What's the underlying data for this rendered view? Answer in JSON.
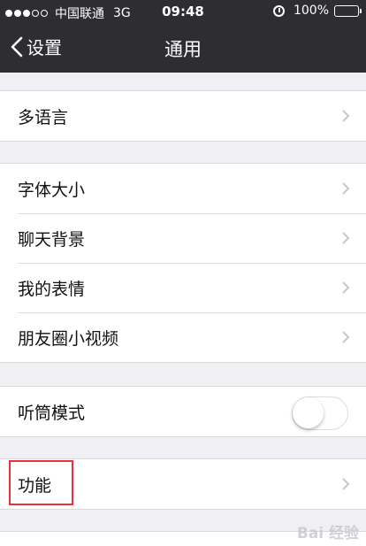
{
  "status_bar": {
    "carrier": "中国联通",
    "network": "3G",
    "time": "09:48",
    "battery": "100%",
    "battery_level": 1.0,
    "signal_bars_filled": 3,
    "signal_bars_total": 5
  },
  "nav": {
    "back_label": "设置",
    "title": "通用"
  },
  "groups": {
    "language": {
      "items": [
        {
          "label": "多语言"
        }
      ]
    },
    "display": {
      "items": [
        {
          "label": "字体大小"
        },
        {
          "label": "聊天背景"
        },
        {
          "label": "我的表情"
        },
        {
          "label": "朋友圈小视频"
        }
      ]
    },
    "earpiece": {
      "label": "听筒模式",
      "toggle_on": false
    },
    "features": {
      "items": [
        {
          "label": "功能"
        }
      ]
    }
  },
  "watermark": {
    "text": "Bai 经验"
  },
  "colors": {
    "nav_bg": "#2e2e32",
    "page_bg": "#efeff4",
    "highlight": "#e8323a"
  }
}
